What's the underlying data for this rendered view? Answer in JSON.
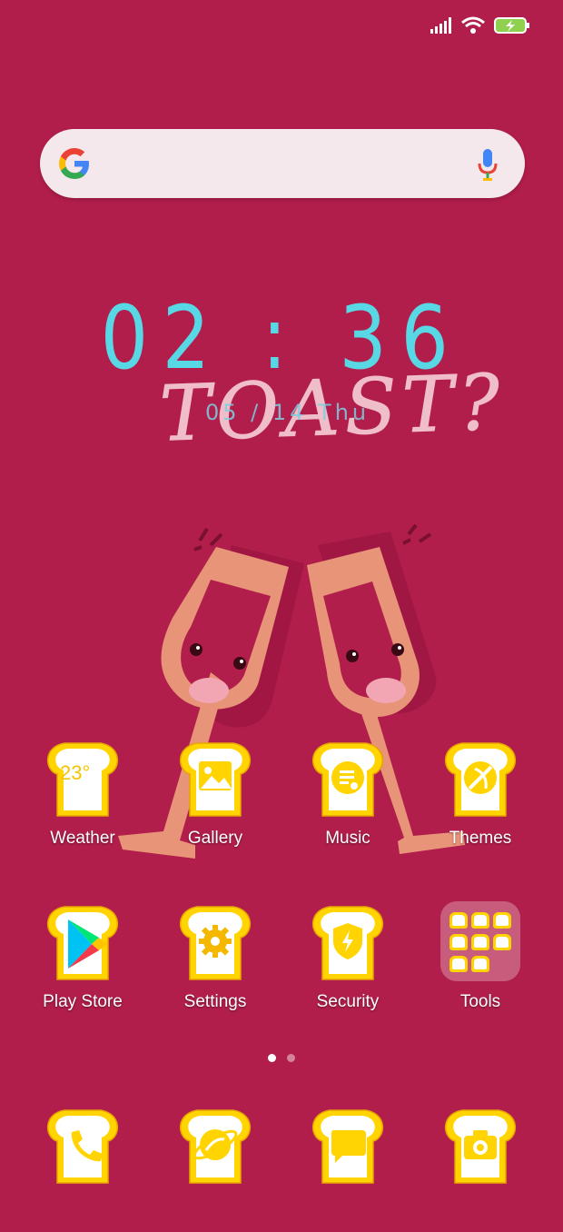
{
  "theme": {
    "background": "#B21E4B",
    "toast_yellow": "#FFD400",
    "clock_color": "#58D7E5"
  },
  "status_bar": {
    "icons": [
      "signal-icon",
      "wifi-icon",
      "battery-charging-icon"
    ]
  },
  "search": {
    "placeholder": ""
  },
  "clock": {
    "time": "02 : 36",
    "date": "05 / 14   Thu"
  },
  "wallpaper": {
    "text": "TOAST?"
  },
  "apps": {
    "row1": [
      {
        "label": "Weather",
        "icon": "weather-icon",
        "temp": "23°"
      },
      {
        "label": "Gallery",
        "icon": "gallery-icon"
      },
      {
        "label": "Music",
        "icon": "music-icon"
      },
      {
        "label": "Themes",
        "icon": "themes-icon"
      }
    ],
    "row2": [
      {
        "label": "Play Store",
        "icon": "play-store-icon"
      },
      {
        "label": "Settings",
        "icon": "settings-icon"
      },
      {
        "label": "Security",
        "icon": "security-icon"
      },
      {
        "label": "Tools",
        "icon": "folder-icon"
      }
    ]
  },
  "page_indicator": {
    "pages": 2,
    "current": 1
  },
  "dock": [
    {
      "icon": "phone-icon"
    },
    {
      "icon": "browser-icon"
    },
    {
      "icon": "messages-icon"
    },
    {
      "icon": "camera-icon"
    }
  ]
}
